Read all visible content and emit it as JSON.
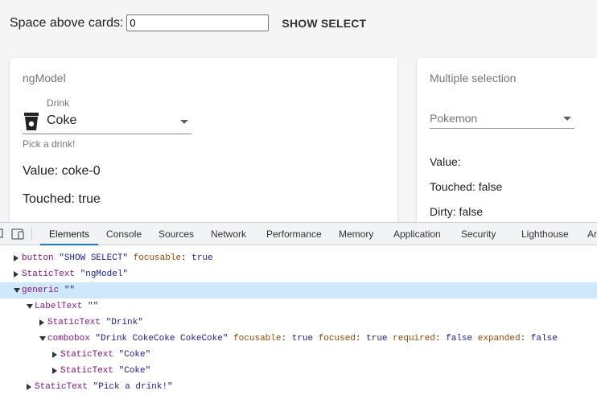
{
  "app": {
    "space_label": "Space above cards:",
    "space_value": "0",
    "show_select_label": "SHOW SELECT",
    "card1": {
      "title": "ngModel",
      "drink_label": "Drink",
      "drink_value": "Coke",
      "hint": "Pick a drink!",
      "value_line": "Value: coke-0",
      "touched_line": "Touched: true"
    },
    "card2": {
      "title": "Multiple selection",
      "placeholder": "Pokemon",
      "value_line": "Value:",
      "touched_line": "Touched: false",
      "dirty_line": "Dirty: false"
    }
  },
  "devtools": {
    "tabs": [
      "Elements",
      "Console",
      "Sources",
      "Network",
      "Performance",
      "Memory",
      "Application",
      "Security",
      "Lighthouse",
      "An"
    ],
    "active_tab": "Elements",
    "tree": [
      {
        "role": "button",
        "name": "\"SHOW SELECT\"",
        "attrs": [
          [
            "focusable",
            "true"
          ]
        ]
      },
      {
        "role": "StaticText",
        "name": "\"ngModel\"",
        "attrs": []
      },
      {
        "role": "generic",
        "name": "\"\"",
        "attrs": []
      },
      {
        "role": "LabelText",
        "name": "\"\"",
        "attrs": []
      },
      {
        "role": "StaticText",
        "name": "\"Drink\"",
        "attrs": []
      },
      {
        "role": "combobox",
        "name": "\"Drink CokeCoke CokeCoke\"",
        "attrs": [
          [
            "focusable",
            "true"
          ],
          [
            "focused",
            "true"
          ],
          [
            "required",
            "false"
          ],
          [
            "expanded",
            "false"
          ]
        ]
      },
      {
        "role": "StaticText",
        "name": "\"Coke\"",
        "attrs": []
      },
      {
        "role": "StaticText",
        "name": "\"Coke\"",
        "attrs": []
      },
      {
        "role": "StaticText",
        "name": "\"Pick a drink!\"",
        "attrs": []
      }
    ]
  }
}
